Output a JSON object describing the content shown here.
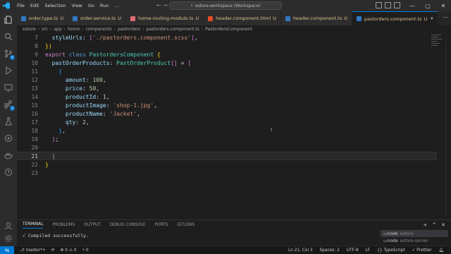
{
  "titlebar": {
    "menu": [
      "File",
      "Edit",
      "Selection",
      "View",
      "Go",
      "Run",
      "…"
    ],
    "search": "estore-workspace (Workspace)"
  },
  "tabs": [
    {
      "label": "order.type.ts",
      "badge": "U",
      "color": "#3178c6"
    },
    {
      "label": "order.service.ts",
      "badge": "U",
      "color": "#3178c6"
    },
    {
      "label": "home-routing.module.ts",
      "badge": "U",
      "color": "#e06c75"
    },
    {
      "label": "header.component.html",
      "badge": "U",
      "color": "#e44d26"
    },
    {
      "label": "header.component.ts",
      "badge": "U",
      "color": "#3178c6"
    },
    {
      "label": "pastorders.component.ts",
      "badge": "U",
      "color": "#3178c6",
      "active": true
    }
  ],
  "breadcrumb": [
    "estore",
    "src",
    "app",
    "home",
    "components",
    "pastorders",
    "pastorders.component.ts",
    "PastordersComponent"
  ],
  "editor": {
    "lines": [
      {
        "n": "7",
        "tokens": [
          [
            "prop",
            "  styleUrls"
          ],
          [
            "punc",
            ": "
          ],
          [
            "br2",
            "["
          ],
          [
            "str",
            "'./pastorders.component.scss'"
          ],
          [
            "br2",
            "]"
          ],
          [
            "punc",
            ","
          ]
        ]
      },
      {
        "n": "8",
        "tokens": [
          [
            "br1",
            "})"
          ]
        ]
      },
      {
        "n": "9",
        "tokens": [
          [
            "kw",
            "export "
          ],
          [
            "kw2",
            "class "
          ],
          [
            "cls",
            "PastordersComponent "
          ],
          [
            "br1",
            "{"
          ]
        ]
      },
      {
        "n": "10",
        "tokens": [
          [
            "prop",
            "  pastOrderProducts"
          ],
          [
            "punc",
            ": "
          ],
          [
            "cls",
            "PastOrderProduct"
          ],
          [
            "br2",
            "[]"
          ],
          [
            "punc",
            " = "
          ],
          [
            "br2",
            "["
          ]
        ]
      },
      {
        "n": "11",
        "tokens": [
          [
            "br3",
            "    {"
          ]
        ]
      },
      {
        "n": "12",
        "tokens": [
          [
            "prop",
            "      amount"
          ],
          [
            "punc",
            ": "
          ],
          [
            "num",
            "100"
          ],
          [
            "punc",
            ","
          ]
        ]
      },
      {
        "n": "13",
        "tokens": [
          [
            "prop",
            "      price"
          ],
          [
            "punc",
            ": "
          ],
          [
            "num",
            "50"
          ],
          [
            "punc",
            ","
          ]
        ]
      },
      {
        "n": "14",
        "tokens": [
          [
            "prop",
            "      productId"
          ],
          [
            "punc",
            ": "
          ],
          [
            "num",
            "1"
          ],
          [
            "punc",
            ","
          ]
        ]
      },
      {
        "n": "15",
        "tokens": [
          [
            "prop",
            "      productImage"
          ],
          [
            "punc",
            ": "
          ],
          [
            "str",
            "'shop-1.jpg'"
          ],
          [
            "punc",
            ","
          ]
        ]
      },
      {
        "n": "16",
        "tokens": [
          [
            "prop",
            "      productName"
          ],
          [
            "punc",
            ": "
          ],
          [
            "str",
            "'Jacket'"
          ],
          [
            "punc",
            ","
          ]
        ]
      },
      {
        "n": "17",
        "tokens": [
          [
            "prop",
            "      qty"
          ],
          [
            "punc",
            ": "
          ],
          [
            "num",
            "2"
          ],
          [
            "punc",
            ","
          ]
        ]
      },
      {
        "n": "18",
        "tokens": [
          [
            "br3",
            "    }"
          ],
          [
            "punc",
            ","
          ]
        ]
      },
      {
        "n": "19",
        "tokens": [
          [
            "br2",
            "  ]"
          ],
          [
            "punc",
            ";"
          ]
        ]
      },
      {
        "n": "20",
        "tokens": []
      },
      {
        "n": "21",
        "tokens": [],
        "current": true
      },
      {
        "n": "22",
        "tokens": [
          [
            "br1",
            "}"
          ]
        ]
      },
      {
        "n": "23",
        "tokens": []
      }
    ]
  },
  "panel": {
    "tabs": [
      "TERMINAL",
      "PROBLEMS",
      "OUTPUT",
      "DEBUG CONSOLE",
      "PORTS",
      "GITLENS"
    ],
    "output_check": "√",
    "output_text": "Compiled successfully.",
    "terminals": [
      {
        "name": "node",
        "sub": "estore"
      },
      {
        "name": "node",
        "sub": "estore-server"
      }
    ]
  },
  "statusbar": {
    "branch": "master*+",
    "errors": "⊗ 0 ⚠ 0",
    "ports": "⑂ 0",
    "position": "Ln 21, Col 3",
    "spaces": "Spaces: 2",
    "encoding": "UTF-8",
    "eol": "LF",
    "language": "{} TypeScript",
    "prettier": "✓ Prettier"
  }
}
